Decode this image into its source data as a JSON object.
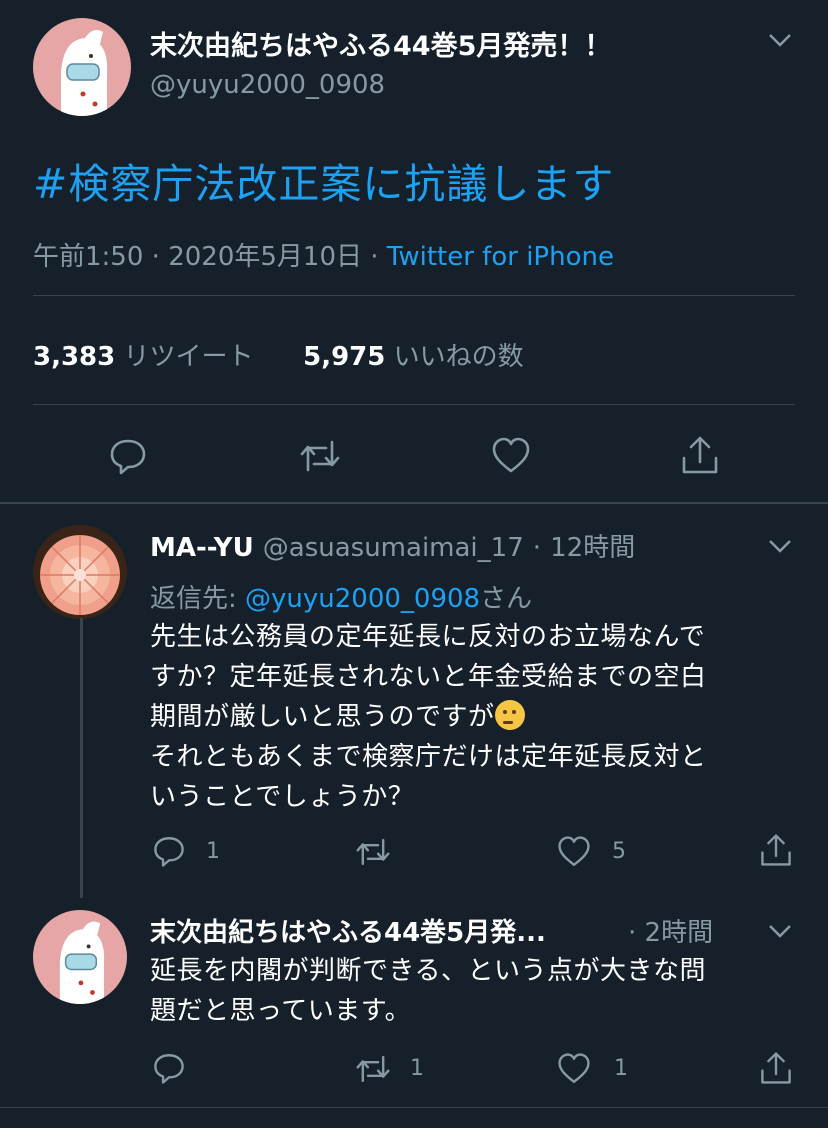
{
  "main_tweet": {
    "display_name": "末次由紀ちはやふる44巻5月発売！！",
    "handle": "@yuyu2000_0908",
    "text": "#検察庁法改正案に抗議します",
    "time": "午前1:50",
    "date": "2020年5月10日",
    "source": "Twitter for iPhone",
    "sep": "·",
    "retweets_count": "3,383",
    "retweets_label": "リツイート",
    "likes_count": "5,975",
    "likes_label": "いいねの数"
  },
  "reply1": {
    "display_name": "MA--YU",
    "handle": "@asuasumaimai_17",
    "sep": "·",
    "time": "12時間",
    "reply_prefix": "返信先:",
    "reply_to": "@yuyu2000_0908",
    "reply_suffix": "さん",
    "line1": "先生は公務員の定年延長に反対のお立場なんで",
    "line2": "すか？定年延長されないと年金受給までの空白",
    "line3": "期間が厳しいと思うのですが",
    "line4": "それともあくまで検察庁だけは定年延長反対と",
    "line5": "いうことでしょうか？",
    "emoji": "thinking-face",
    "reply_count": "1",
    "retweet_count": "",
    "like_count": "5"
  },
  "reply2": {
    "display_name": "末次由紀ちはやふる44巻5月発...",
    "sep": "·",
    "time": "2時間",
    "line1": "延長を内閣が判断できる、という点が大きな問",
    "line2": "題だと思っています。",
    "reply_count": "",
    "retweet_count": "1",
    "like_count": "1"
  },
  "colors": {
    "background": "#15202b",
    "accent": "#1da1f2",
    "muted": "#8899a6",
    "divider": "#38444d"
  }
}
